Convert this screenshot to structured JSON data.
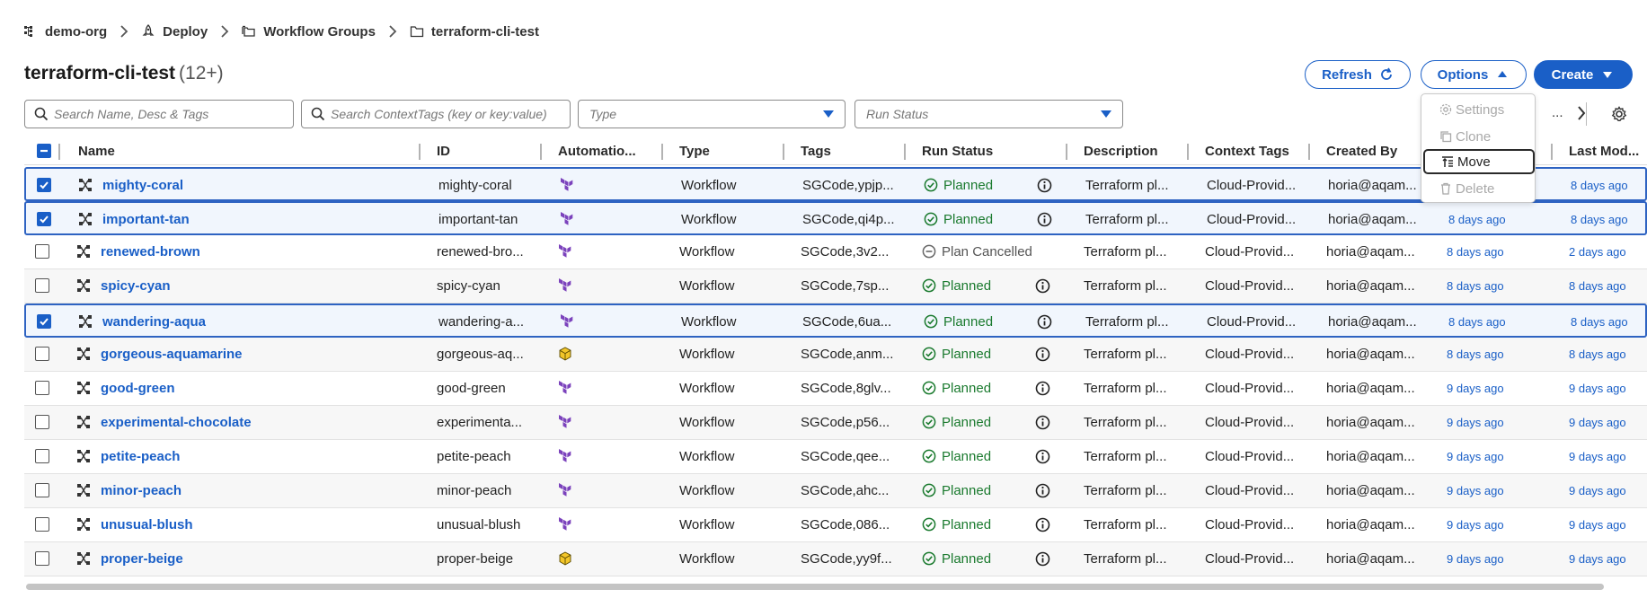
{
  "breadcrumb": [
    {
      "label": "demo-org",
      "icon": "org-tree-icon"
    },
    {
      "label": "Deploy",
      "icon": "rocket-icon"
    },
    {
      "label": "Workflow Groups",
      "icon": "folders-icon"
    },
    {
      "label": "terraform-cli-test",
      "icon": "folder-icon"
    }
  ],
  "header": {
    "title": "terraform-cli-test",
    "count": "(12+)",
    "refresh_label": "Refresh",
    "options_label": "Options",
    "create_label": "Create"
  },
  "filters": {
    "search_name_placeholder": "Search Name, Desc & Tags",
    "search_context_placeholder": "Search ContextTags (key or key:value)",
    "type_placeholder": "Type",
    "run_status_placeholder": "Run Status"
  },
  "pager": {
    "ellipsis": "..."
  },
  "options_menu": {
    "items": [
      {
        "label": "Settings",
        "disabled": true
      },
      {
        "label": "Clone",
        "disabled": true
      },
      {
        "label": "Move",
        "disabled": false
      },
      {
        "label": "Delete",
        "disabled": true
      }
    ]
  },
  "table": {
    "columns": [
      "Name",
      "ID",
      "Automatio...",
      "Type",
      "Tags",
      "Run Status",
      "Description",
      "Context Tags",
      "Created By",
      "Last Mod..."
    ],
    "rows": [
      {
        "name": "mighty-coral",
        "id": "mighty-coral",
        "automation": "terraform",
        "type": "Workflow",
        "tags": "SGCode,ypjp...",
        "status": "Planned",
        "description": "Terraform pl...",
        "context_tags": "Cloud-Provid...",
        "created_by": "horia@aqam...",
        "created": "",
        "modified": "8 days ago",
        "selected": true
      },
      {
        "name": "important-tan",
        "id": "important-tan",
        "automation": "terraform",
        "type": "Workflow",
        "tags": "SGCode,qi4p...",
        "status": "Planned",
        "description": "Terraform pl...",
        "context_tags": "Cloud-Provid...",
        "created_by": "horia@aqam...",
        "created": "8 days ago",
        "modified": "8 days ago",
        "selected": true
      },
      {
        "name": "renewed-brown",
        "id": "renewed-bro...",
        "automation": "terraform",
        "type": "Workflow",
        "tags": "SGCode,3v2...",
        "status": "Plan Cancelled",
        "description": "Terraform pl...",
        "context_tags": "Cloud-Provid...",
        "created_by": "horia@aqam...",
        "created": "8 days ago",
        "modified": "2 days ago",
        "selected": false
      },
      {
        "name": "spicy-cyan",
        "id": "spicy-cyan",
        "automation": "terraform",
        "type": "Workflow",
        "tags": "SGCode,7sp...",
        "status": "Planned",
        "description": "Terraform pl...",
        "context_tags": "Cloud-Provid...",
        "created_by": "horia@aqam...",
        "created": "8 days ago",
        "modified": "8 days ago",
        "selected": false
      },
      {
        "name": "wandering-aqua",
        "id": "wandering-a...",
        "automation": "terraform",
        "type": "Workflow",
        "tags": "SGCode,6ua...",
        "status": "Planned",
        "description": "Terraform pl...",
        "context_tags": "Cloud-Provid...",
        "created_by": "horia@aqam...",
        "created": "8 days ago",
        "modified": "8 days ago",
        "selected": true
      },
      {
        "name": "gorgeous-aquamarine",
        "id": "gorgeous-aq...",
        "automation": "cube",
        "type": "Workflow",
        "tags": "SGCode,anm...",
        "status": "Planned",
        "description": "Terraform pl...",
        "context_tags": "Cloud-Provid...",
        "created_by": "horia@aqam...",
        "created": "8 days ago",
        "modified": "8 days ago",
        "selected": false
      },
      {
        "name": "good-green",
        "id": "good-green",
        "automation": "terraform",
        "type": "Workflow",
        "tags": "SGCode,8glv...",
        "status": "Planned",
        "description": "Terraform pl...",
        "context_tags": "Cloud-Provid...",
        "created_by": "horia@aqam...",
        "created": "9 days ago",
        "modified": "9 days ago",
        "selected": false
      },
      {
        "name": "experimental-chocolate",
        "id": "experimenta...",
        "automation": "terraform",
        "type": "Workflow",
        "tags": "SGCode,p56...",
        "status": "Planned",
        "description": "Terraform pl...",
        "context_tags": "Cloud-Provid...",
        "created_by": "horia@aqam...",
        "created": "9 days ago",
        "modified": "9 days ago",
        "selected": false
      },
      {
        "name": "petite-peach",
        "id": "petite-peach",
        "automation": "terraform",
        "type": "Workflow",
        "tags": "SGCode,qee...",
        "status": "Planned",
        "description": "Terraform pl...",
        "context_tags": "Cloud-Provid...",
        "created_by": "horia@aqam...",
        "created": "9 days ago",
        "modified": "9 days ago",
        "selected": false
      },
      {
        "name": "minor-peach",
        "id": "minor-peach",
        "automation": "terraform",
        "type": "Workflow",
        "tags": "SGCode,ahc...",
        "status": "Planned",
        "description": "Terraform pl...",
        "context_tags": "Cloud-Provid...",
        "created_by": "horia@aqam...",
        "created": "9 days ago",
        "modified": "9 days ago",
        "selected": false
      },
      {
        "name": "unusual-blush",
        "id": "unusual-blush",
        "automation": "terraform",
        "type": "Workflow",
        "tags": "SGCode,086...",
        "status": "Planned",
        "description": "Terraform pl...",
        "context_tags": "Cloud-Provid...",
        "created_by": "horia@aqam...",
        "created": "9 days ago",
        "modified": "9 days ago",
        "selected": false
      },
      {
        "name": "proper-beige",
        "id": "proper-beige",
        "automation": "cube",
        "type": "Workflow",
        "tags": "SGCode,yy9f...",
        "status": "Planned",
        "description": "Terraform pl...",
        "context_tags": "Cloud-Provid...",
        "created_by": "horia@aqam...",
        "created": "9 days ago",
        "modified": "9 days ago",
        "selected": false
      }
    ]
  },
  "colors": {
    "accent": "#1a5fc7",
    "status_ok": "#1a7a2e",
    "selected_row_border": "#2e63c2",
    "terraform_purple": "#7b42bc"
  }
}
